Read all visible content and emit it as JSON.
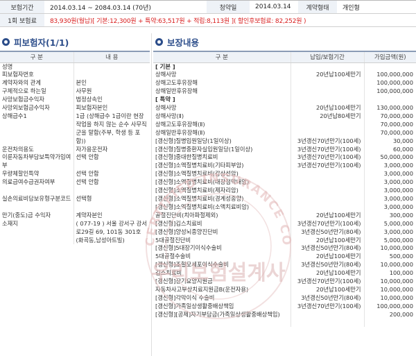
{
  "summary": {
    "period_label": "보험기간",
    "period_value": "2014.03.14  ~ 2084.03.14  (70년)",
    "signup_label": "청약일",
    "signup_value": "2014.03.14",
    "contract_type_label": "계약형태",
    "contract_type_value": "개인형",
    "premium_label": "1회 보험료",
    "premium_value": "83,930원(월납)[ 기본:12,300원 + 특약:63,517원 + 적립:8,113원 ]( 할인후보험료: 82,252원 )"
  },
  "insured": {
    "title": "피보험자(1/1)",
    "col_category": "구     분",
    "col_content": "내     용",
    "rows": [
      {
        "k": "성명",
        "v": ""
      },
      {
        "k": "피보험자번호",
        "v": ""
      },
      {
        "k": "계약자와의 관계",
        "v": "본인"
      },
      {
        "k": "구체적으로 하는일",
        "v": "사무원"
      },
      {
        "k": "사망보험금수익자",
        "v": "법정상속인"
      },
      {
        "k": "사망외보험금수익자",
        "v": "피보험자본인"
      },
      {
        "k": "상해급수1",
        "v": "1급 (상해급수 1급이란 현장 작업을 하지 않는 순수 사무직군을 말함(주부, 학생 등 포함))"
      },
      {
        "k": "운전차의용도",
        "v": "자가용운전자"
      },
      {
        "k": "이륜자동차부담보특약가입여부",
        "v": "선택 안함"
      },
      {
        "k": "우량체할인특약",
        "v": "선택 안함"
      },
      {
        "k": "의료급여수급권자여부",
        "v": "선택 안함"
      },
      {
        "k": "실손의료비담보유형구분코드",
        "v": "선택형"
      },
      {
        "k": "만기(중도)금 수익자",
        "v": "계약자본인"
      },
      {
        "k": "소재지",
        "v": "( 077-19 ) 서울 강서구 강서로29길 69, 101동 301호 (화곡동,남성아트빌)"
      }
    ]
  },
  "coverage": {
    "title": "보장내용",
    "col_category": "구     분",
    "col_period": "납입/보험기간",
    "col_amount": "가입금액(원)",
    "rows": [
      {
        "n": "[ 기본 ]",
        "p": "",
        "a": "",
        "h": true
      },
      {
        "n": "상해사망",
        "p": "20년납100세만기",
        "a": "100,000,000"
      },
      {
        "n": "상해고도후유장해",
        "p": "",
        "a": "100,000,000"
      },
      {
        "n": "상해일반후유장해",
        "p": "",
        "a": "100,000,000"
      },
      {
        "n": "[ 특약 ]",
        "p": "",
        "a": "",
        "h": true
      },
      {
        "n": "상해사망",
        "p": "20년납100세만기",
        "a": "130,000,000"
      },
      {
        "n": "상해사망(Ⅱ)",
        "p": "20년납80세만기",
        "a": "70,000,000"
      },
      {
        "n": "상해고도후유장해(Ⅱ)",
        "p": "",
        "a": "70,000,000"
      },
      {
        "n": "상해일반후유장해(Ⅱ)",
        "p": "",
        "a": "70,000,000"
      },
      {
        "n": "[갱신형]질병입원일당(1일이상)",
        "p": "3년갱신70년만기(100세)",
        "a": "30,000"
      },
      {
        "n": "[갱신형]질병중환자실입원일당(1일이상)",
        "p": "3년갱신70년만기(100세)",
        "a": "60,000"
      },
      {
        "n": "[갱신형]중대한질병치료비",
        "p": "3년갱신70년만기(100세)",
        "a": "50,000,000"
      },
      {
        "n": "[갱신형]소액질병치료비(기타피부암)",
        "p": "3년갱신70년만기(100세)",
        "a": "3,000,000"
      },
      {
        "n": "[갱신형]소액질병치료비(갑상선암)",
        "p": "",
        "a": "3,000,000"
      },
      {
        "n": "[갱신형]소액질병치료비(대장점막내암)",
        "p": "",
        "a": "3,000,000"
      },
      {
        "n": "[갱신형]소액질병치료비(제자리암)",
        "p": "",
        "a": "3,000,000"
      },
      {
        "n": "[갱신형]소액질병치료비(경계성종양)",
        "p": "",
        "a": "3,000,000"
      },
      {
        "n": "[갱신형]소액질병치료비(소액치료비암)",
        "p": "",
        "a": "3,000,000"
      },
      {
        "n": "골절진단비(치아파절제외)",
        "p": "20년납100세만기",
        "a": "300,000"
      },
      {
        "n": "[갱신형]깁스치료비",
        "p": "3년갱신70년만기(100세)",
        "a": "5,000,000"
      },
      {
        "n": "[갱신형]양성뇌종양진단비",
        "p": "3년갱신50년만기(80세)",
        "a": "3,000,000"
      },
      {
        "n": "5대골절진단비",
        "p": "20년납100세만기",
        "a": "5,000,000"
      },
      {
        "n": "[갱신형]5대장기이식수술비",
        "p": "3년갱신50년만기(80세)",
        "a": "10,000,000"
      },
      {
        "n": "5대골절수술비",
        "p": "20년납100세만기",
        "a": "500,000"
      },
      {
        "n": "[갱신형]조혈모세포이식수술비",
        "p": "3년갱신50년만기(80세)",
        "a": "10,000,000"
      },
      {
        "n": "깁스치료비",
        "p": "20년납100세만기",
        "a": "100,000"
      },
      {
        "n": "[갱신형]장기요양지원금",
        "p": "3년갱신70년만기(100세)",
        "a": "10,000,000"
      },
      {
        "n": "자동차사고부상치료지원금B(운전자용)",
        "p": "20년납100세만기",
        "a": "10,000,000"
      },
      {
        "n": "[갱신형]각막이식 수술비",
        "p": "3년갱신50년만기(80세)",
        "a": "10,000,000"
      },
      {
        "n": "[갱신형]가족일상생활중배상책임",
        "p": "3년갱신70년만기(100세)",
        "a": "100,000,000"
      },
      {
        "n": "[갱신형][공제]자기부담금(가족일상생활중배상책임)",
        "p": "",
        "a": "200,000"
      }
    ]
  },
  "watermark": {
    "top_text": "CERTIFIED INSURANCE CONSULTANT",
    "bottom_text": "우리보험설계사"
  }
}
